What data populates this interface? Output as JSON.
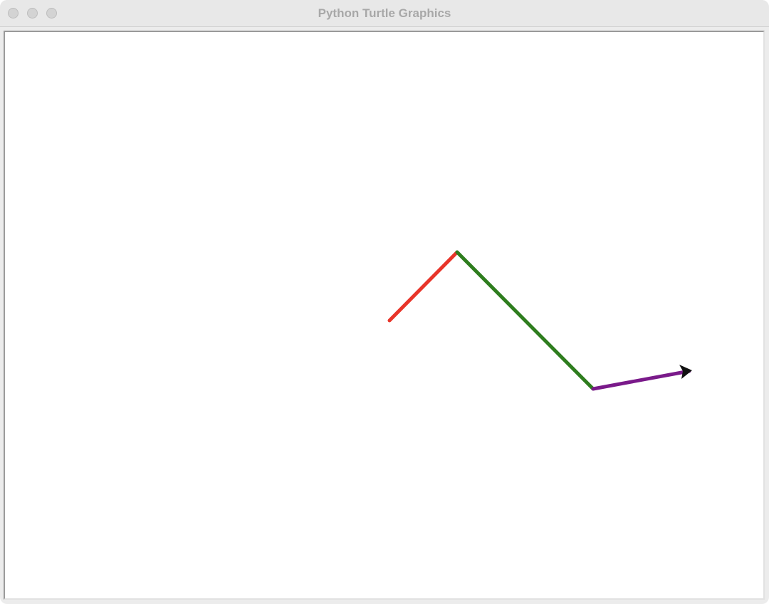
{
  "window": {
    "title": "Python Turtle Graphics"
  },
  "controls": [
    "close-button",
    "minimize-button",
    "zoom-button"
  ],
  "canvas": {
    "background": "#ffffff",
    "segments": [
      {
        "color": "#e8352a"
      },
      {
        "color": "#2e7d1e"
      },
      {
        "color": "#7a1a8a"
      }
    ],
    "turtle_color": "#111111"
  }
}
